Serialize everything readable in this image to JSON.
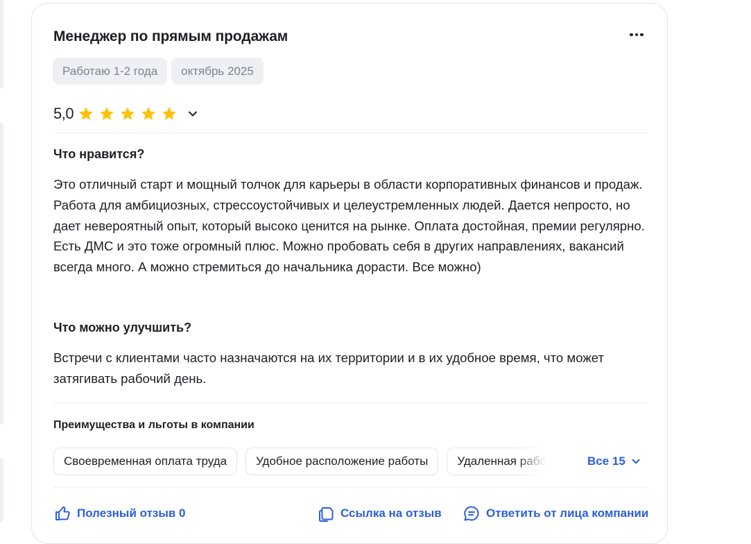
{
  "review": {
    "title": "Менеджер по прямым продажам",
    "tags": [
      "Работаю 1-2 года",
      "октябрь 2025"
    ],
    "rating": "5,0",
    "stars": 5,
    "likes_label": "Что нравится?",
    "likes_text": "Это отличный старт и мощный толчок для карьеры в области корпоративных финансов и продаж. Работа для амбициозных, стрессоустойчивых и целеустремленных людей. Дается непросто, но дает невероятный опыт, который высоко ценится на рынке. Оплата достойная, премии регулярно. Есть ДМС и это тоже огромный плюс. Можно пробовать себя в других направлениях, вакансий всегда много. А можно стремиться до начальника дорасти. Все можно)",
    "improve_label": "Что можно улучшить?",
    "improve_text": "Встречи с клиентами часто назначаются на их территории и в их удобное время, что может затягивать рабочий день.",
    "benefits": {
      "label": "Преимущества и льготы в компании",
      "items": [
        "Своевременная оплата труда",
        "Удобное расположение работы",
        "Удаленная работа"
      ],
      "show_all": "Все 15"
    },
    "actions": {
      "useful": "Полезный отзыв 0",
      "link": "Ссылка на отзыв",
      "reply": "Ответить от лица компании"
    }
  },
  "colors": {
    "star": "#FFC107",
    "link": "#2B5FD9",
    "tag_bg": "#EEF0F4",
    "tag_text": "#7A8293"
  },
  "icons": [
    "more-icon",
    "star-icon",
    "chevron-down-icon",
    "thumb-up-icon",
    "copy-icon",
    "chat-icon"
  ]
}
